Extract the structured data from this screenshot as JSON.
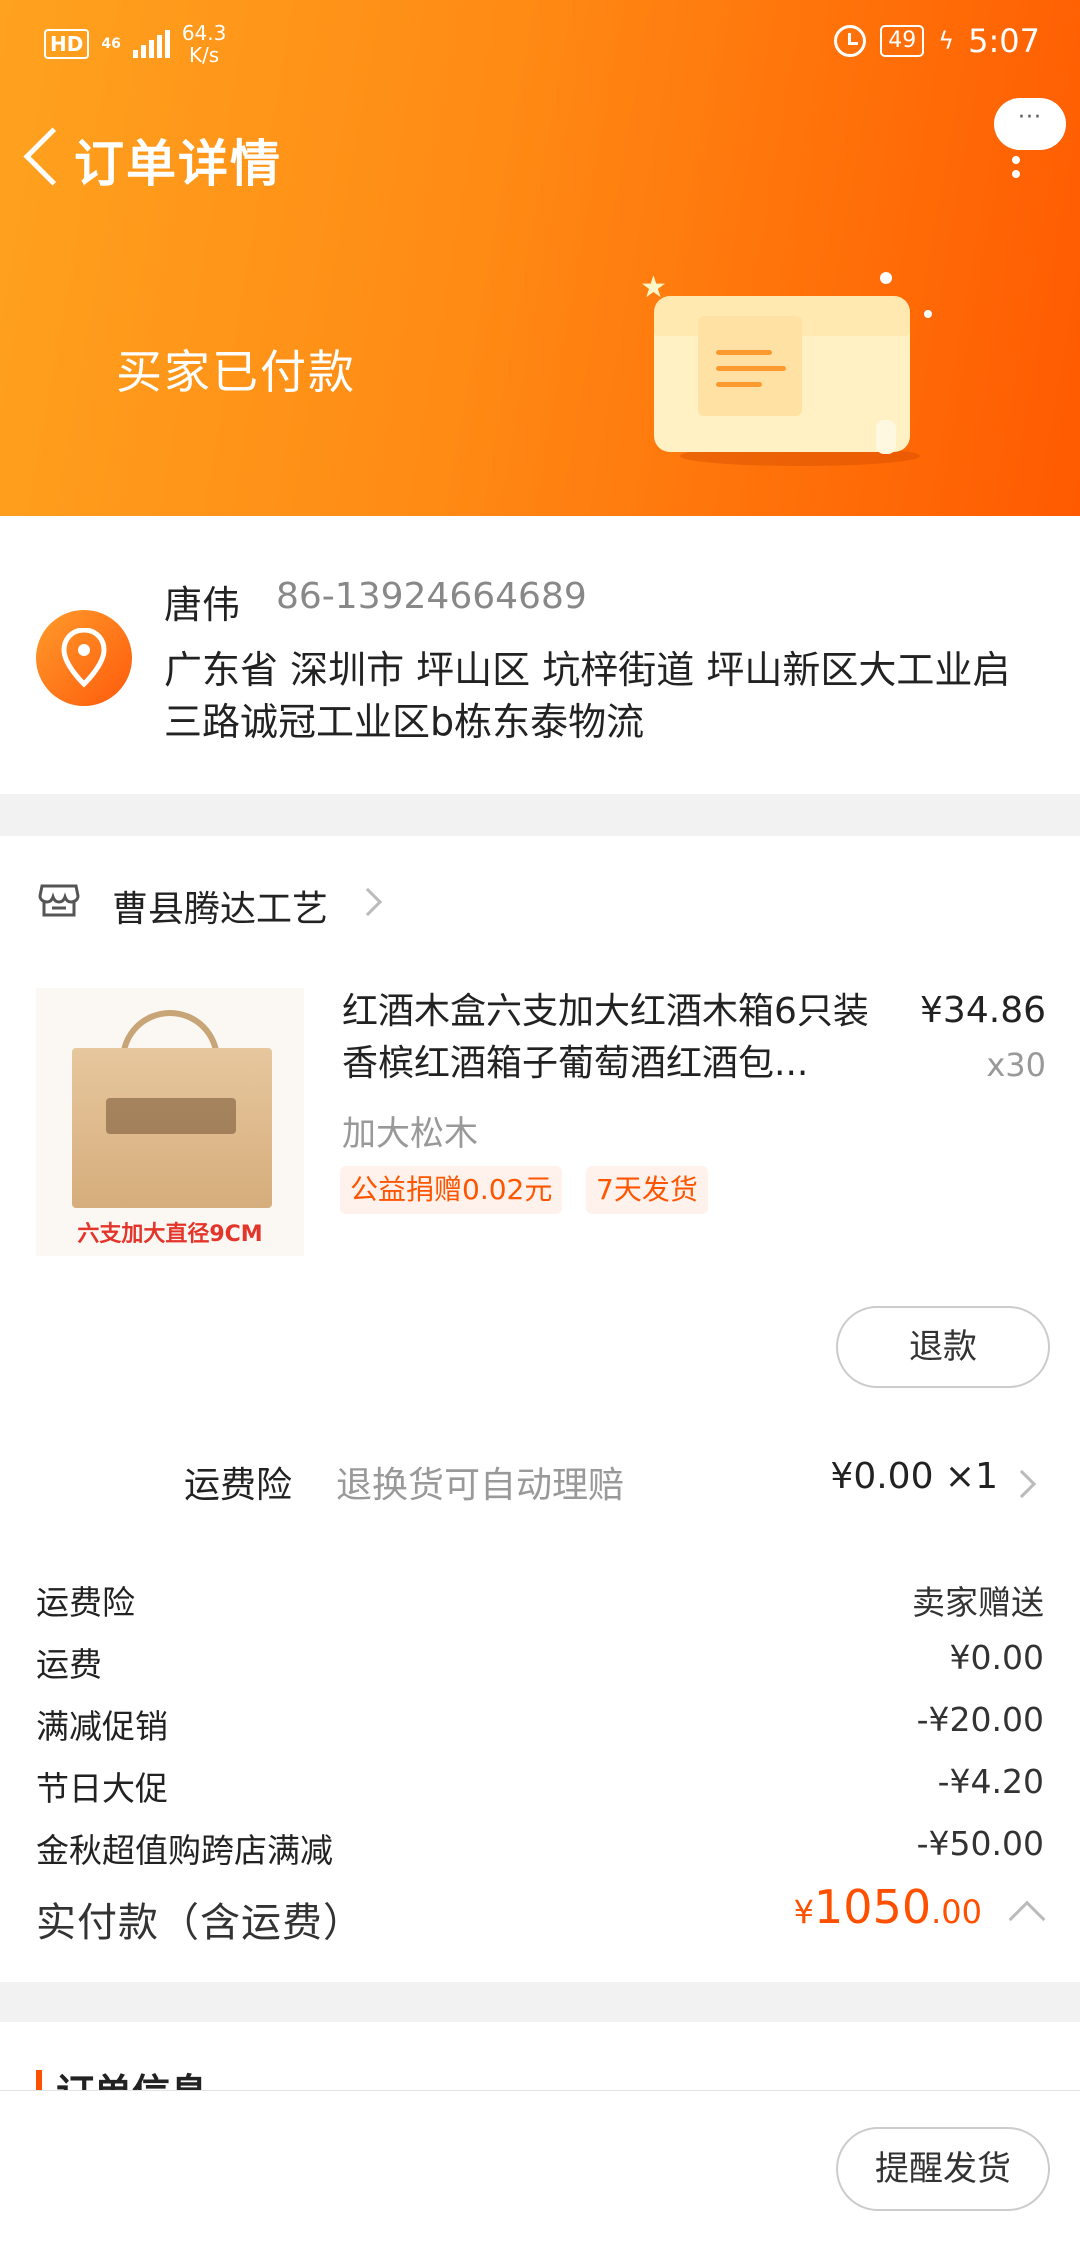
{
  "status_bar": {
    "hd": "HD",
    "network": "46",
    "speed_value": "64.3",
    "speed_unit": "K/s",
    "battery": "49",
    "time": "5:07"
  },
  "nav": {
    "title": "订单详情",
    "more_label": "···"
  },
  "header": {
    "status_text": "买家已付款"
  },
  "address": {
    "name": "唐伟",
    "phone": "86-13924664689",
    "full_address": "广东省 深圳市 坪山区 坑梓街道 坪山新区大工业启三路诚冠工业区b栋东泰物流"
  },
  "shop": {
    "name": "曹县腾达工艺"
  },
  "item": {
    "title": "红酒木盒六支加大红酒木箱6只装香槟红酒箱子葡萄酒红酒包...",
    "price": "¥34.86",
    "qty": "x30",
    "spec": "加大松木",
    "thumb_caption": "六支加大直径9CM",
    "tags": [
      "公益捐赠0.02元",
      "7天发货"
    ]
  },
  "refund_button": "退款",
  "shipping_insurance": {
    "label": "运费险",
    "desc": "退换货可自动理赔",
    "value": "¥0.00 ×1"
  },
  "fees": [
    {
      "label": "运费险",
      "value": "卖家赠送"
    },
    {
      "label": "运费",
      "value": "¥0.00"
    },
    {
      "label": "满减促销",
      "value": "-¥20.00"
    },
    {
      "label": "节日大促",
      "value": "-¥4.20"
    },
    {
      "label": "金秋超值购跨店满减",
      "value": "-¥50.00"
    }
  ],
  "total": {
    "label": "实付款（含运费）",
    "currency": "¥",
    "integer": "1050",
    "decimal": ".00"
  },
  "order_info": {
    "title": "订单信息"
  },
  "bottom": {
    "remind_button": "提醒发货"
  },
  "colors": {
    "accent": "#ff5000",
    "header_start": "#ffa21f",
    "header_end": "#ff5a00"
  }
}
